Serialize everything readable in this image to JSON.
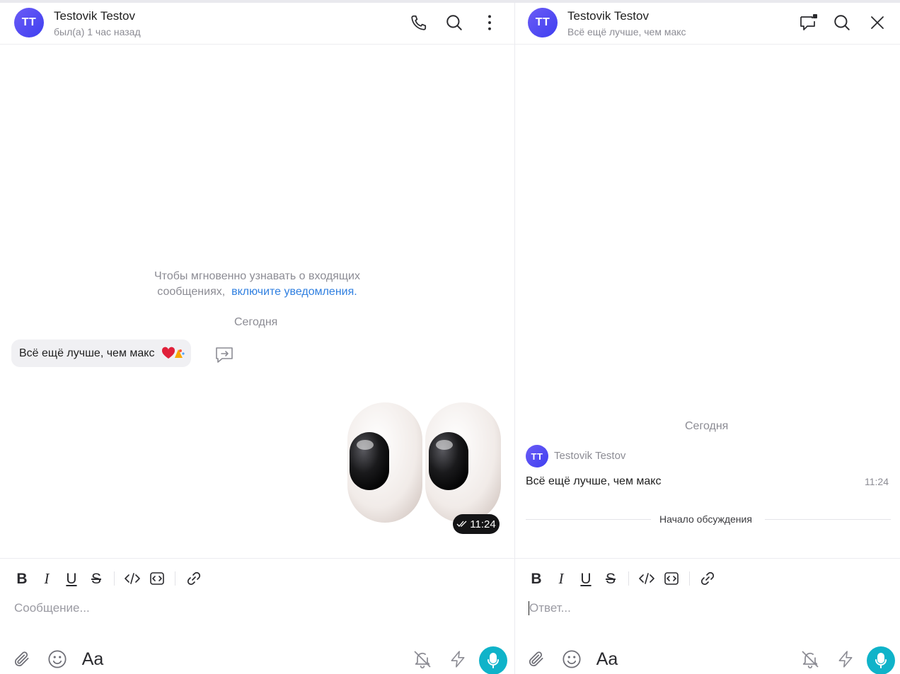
{
  "colors": {
    "avatar": "#4b45f2",
    "link": "#2f7fe0",
    "mic_button": "#0fb3c9",
    "bubble": "#f0f0f3",
    "muted_text": "#8c8c94"
  },
  "left_chat": {
    "avatar_initials": "TT",
    "contact_name": "Testovik Testov",
    "status": "был(а) 1 час назад",
    "header_icons": [
      "phone-icon",
      "search-icon",
      "more-vertical-icon"
    ],
    "notice_line1": "Чтобы мгновенно узнавать о входящих",
    "notice_line2": "сообщениях,",
    "notice_link": "включите уведомления.",
    "date_separator": "Сегодня",
    "message_text": "Всё ещё лучше, чем макс",
    "message_reactions": [
      "heart-emoji",
      "party-emoji"
    ],
    "sticker": "eyes-sticker",
    "sticker_time": "11:24",
    "composer": {
      "format_buttons": [
        "B",
        "I",
        "U",
        "S"
      ],
      "placeholder": "Сообщение..."
    }
  },
  "right_thread": {
    "avatar_initials": "TT",
    "title": "Testovik Testov",
    "subtitle": "Всё ещё лучше, чем макс",
    "header_icons": [
      "comments-icon",
      "search-icon",
      "close-icon"
    ],
    "date_separator": "Сегодня",
    "author": "Testovik Testov",
    "message_text": "Всё ещё лучше, чем макс",
    "message_time": "11:24",
    "thread_start_label": "Начало обсуждения",
    "composer": {
      "format_buttons": [
        "B",
        "I",
        "U",
        "S"
      ],
      "placeholder": "Ответ..."
    }
  },
  "composer_labels": {
    "font_toggle": "Aa"
  }
}
